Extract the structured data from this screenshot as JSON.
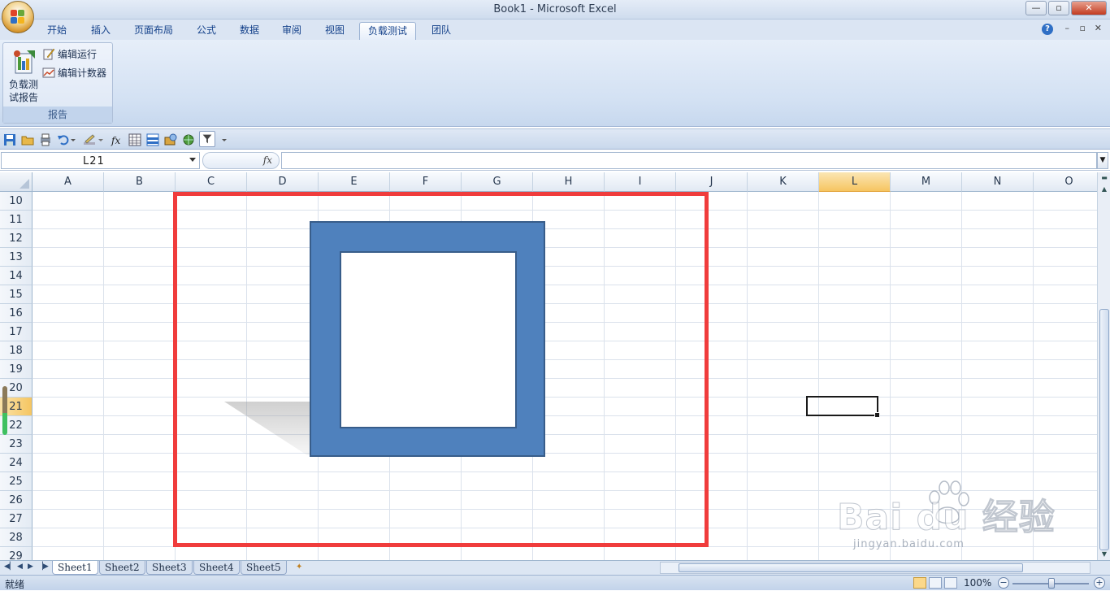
{
  "window": {
    "title": "Book1 - Microsoft Excel",
    "min": "—",
    "max": "▫",
    "close": "✕"
  },
  "tabs": [
    {
      "label": "开始",
      "active": false
    },
    {
      "label": "插入",
      "active": false
    },
    {
      "label": "页面布局",
      "active": false
    },
    {
      "label": "公式",
      "active": false
    },
    {
      "label": "数据",
      "active": false
    },
    {
      "label": "审阅",
      "active": false
    },
    {
      "label": "视图",
      "active": false
    },
    {
      "label": "负载测试",
      "active": true
    },
    {
      "label": "团队",
      "active": false
    }
  ],
  "ribbon": {
    "big_button": "负载测\n试报告",
    "edit_run": "编辑运行",
    "edit_counter": "编辑计数器",
    "group_label": "报告"
  },
  "formula_bar": {
    "name_box": "L21",
    "fx": "fx",
    "value": ""
  },
  "columns": [
    "A",
    "B",
    "C",
    "D",
    "E",
    "F",
    "G",
    "H",
    "I",
    "J",
    "K",
    "L",
    "M",
    "N",
    "O"
  ],
  "selected_column": "L",
  "rows": [
    "10",
    "11",
    "12",
    "13",
    "14",
    "15",
    "16",
    "17",
    "18",
    "19",
    "20",
    "21",
    "22",
    "23",
    "24",
    "25",
    "26",
    "27",
    "28",
    "29"
  ],
  "selected_row": "21",
  "sheet_tabs": [
    {
      "label": "Sheet1",
      "active": true
    },
    {
      "label": "Sheet2",
      "active": false
    },
    {
      "label": "Sheet3",
      "active": false
    },
    {
      "label": "Sheet4",
      "active": false
    },
    {
      "label": "Sheet5",
      "active": false
    }
  ],
  "status": {
    "text": "就绪",
    "zoom": "100%"
  },
  "colors": {
    "shape_fill": "#4f81bd",
    "shape_border": "#385d8a",
    "highlight": "#f03c3c",
    "selected_header": "#f6c561"
  },
  "watermark": {
    "brand": "Bai  du 经验",
    "url": "jingyan.baidu.com"
  }
}
